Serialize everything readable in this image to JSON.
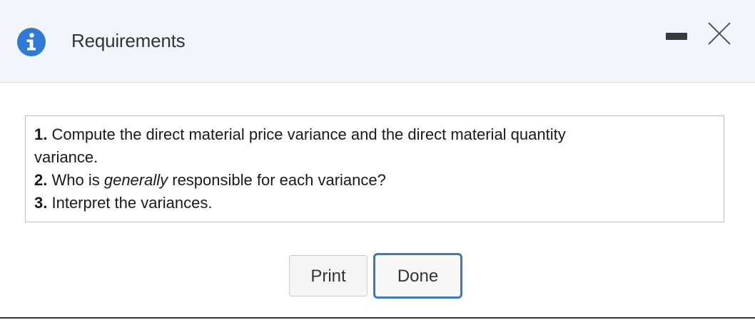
{
  "dialog": {
    "title": "Requirements",
    "colors": {
      "titlebar_bg": "#f2f6fb",
      "info_icon": "#2f7ad6",
      "done_border": "#3d7ab8"
    },
    "icons": {
      "info": "info-icon",
      "minimize": "minimize-icon",
      "close": "close-icon"
    }
  },
  "requirements": [
    {
      "number": "1.",
      "text": "Compute the direct material price variance and the direct material quantity"
    },
    {
      "number": "",
      "text": "variance."
    },
    {
      "number": "2.",
      "pre": "Who is ",
      "emph": "generally",
      "post": " responsible for each variance?"
    },
    {
      "number": "3.",
      "text": "Interpret the variances."
    }
  ],
  "buttons": {
    "print_label": "Print",
    "done_label": "Done"
  }
}
